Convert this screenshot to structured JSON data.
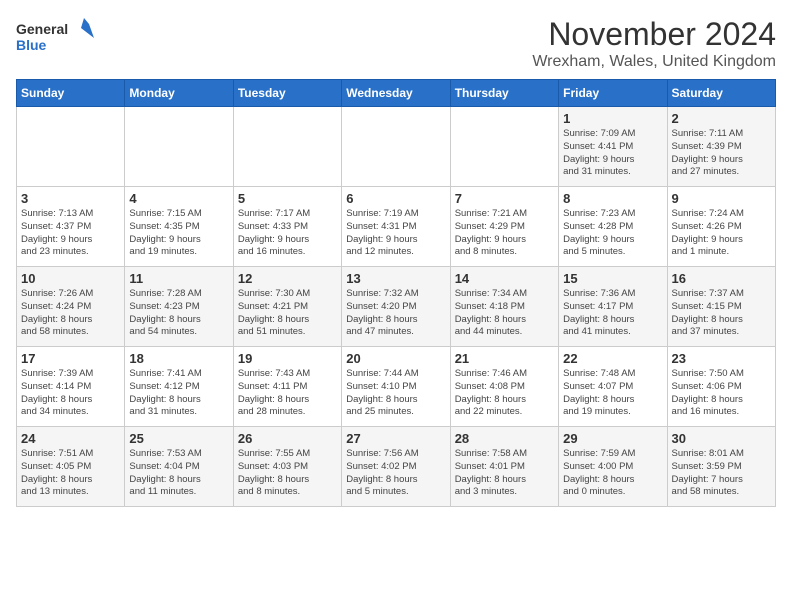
{
  "logo": {
    "line1": "General",
    "line2": "Blue"
  },
  "title": "November 2024",
  "subtitle": "Wrexham, Wales, United Kingdom",
  "days_of_week": [
    "Sunday",
    "Monday",
    "Tuesday",
    "Wednesday",
    "Thursday",
    "Friday",
    "Saturday"
  ],
  "weeks": [
    [
      {
        "day": "",
        "info": ""
      },
      {
        "day": "",
        "info": ""
      },
      {
        "day": "",
        "info": ""
      },
      {
        "day": "",
        "info": ""
      },
      {
        "day": "",
        "info": ""
      },
      {
        "day": "1",
        "info": "Sunrise: 7:09 AM\nSunset: 4:41 PM\nDaylight: 9 hours\nand 31 minutes."
      },
      {
        "day": "2",
        "info": "Sunrise: 7:11 AM\nSunset: 4:39 PM\nDaylight: 9 hours\nand 27 minutes."
      }
    ],
    [
      {
        "day": "3",
        "info": "Sunrise: 7:13 AM\nSunset: 4:37 PM\nDaylight: 9 hours\nand 23 minutes."
      },
      {
        "day": "4",
        "info": "Sunrise: 7:15 AM\nSunset: 4:35 PM\nDaylight: 9 hours\nand 19 minutes."
      },
      {
        "day": "5",
        "info": "Sunrise: 7:17 AM\nSunset: 4:33 PM\nDaylight: 9 hours\nand 16 minutes."
      },
      {
        "day": "6",
        "info": "Sunrise: 7:19 AM\nSunset: 4:31 PM\nDaylight: 9 hours\nand 12 minutes."
      },
      {
        "day": "7",
        "info": "Sunrise: 7:21 AM\nSunset: 4:29 PM\nDaylight: 9 hours\nand 8 minutes."
      },
      {
        "day": "8",
        "info": "Sunrise: 7:23 AM\nSunset: 4:28 PM\nDaylight: 9 hours\nand 5 minutes."
      },
      {
        "day": "9",
        "info": "Sunrise: 7:24 AM\nSunset: 4:26 PM\nDaylight: 9 hours\nand 1 minute."
      }
    ],
    [
      {
        "day": "10",
        "info": "Sunrise: 7:26 AM\nSunset: 4:24 PM\nDaylight: 8 hours\nand 58 minutes."
      },
      {
        "day": "11",
        "info": "Sunrise: 7:28 AM\nSunset: 4:23 PM\nDaylight: 8 hours\nand 54 minutes."
      },
      {
        "day": "12",
        "info": "Sunrise: 7:30 AM\nSunset: 4:21 PM\nDaylight: 8 hours\nand 51 minutes."
      },
      {
        "day": "13",
        "info": "Sunrise: 7:32 AM\nSunset: 4:20 PM\nDaylight: 8 hours\nand 47 minutes."
      },
      {
        "day": "14",
        "info": "Sunrise: 7:34 AM\nSunset: 4:18 PM\nDaylight: 8 hours\nand 44 minutes."
      },
      {
        "day": "15",
        "info": "Sunrise: 7:36 AM\nSunset: 4:17 PM\nDaylight: 8 hours\nand 41 minutes."
      },
      {
        "day": "16",
        "info": "Sunrise: 7:37 AM\nSunset: 4:15 PM\nDaylight: 8 hours\nand 37 minutes."
      }
    ],
    [
      {
        "day": "17",
        "info": "Sunrise: 7:39 AM\nSunset: 4:14 PM\nDaylight: 8 hours\nand 34 minutes."
      },
      {
        "day": "18",
        "info": "Sunrise: 7:41 AM\nSunset: 4:12 PM\nDaylight: 8 hours\nand 31 minutes."
      },
      {
        "day": "19",
        "info": "Sunrise: 7:43 AM\nSunset: 4:11 PM\nDaylight: 8 hours\nand 28 minutes."
      },
      {
        "day": "20",
        "info": "Sunrise: 7:44 AM\nSunset: 4:10 PM\nDaylight: 8 hours\nand 25 minutes."
      },
      {
        "day": "21",
        "info": "Sunrise: 7:46 AM\nSunset: 4:08 PM\nDaylight: 8 hours\nand 22 minutes."
      },
      {
        "day": "22",
        "info": "Sunrise: 7:48 AM\nSunset: 4:07 PM\nDaylight: 8 hours\nand 19 minutes."
      },
      {
        "day": "23",
        "info": "Sunrise: 7:50 AM\nSunset: 4:06 PM\nDaylight: 8 hours\nand 16 minutes."
      }
    ],
    [
      {
        "day": "24",
        "info": "Sunrise: 7:51 AM\nSunset: 4:05 PM\nDaylight: 8 hours\nand 13 minutes."
      },
      {
        "day": "25",
        "info": "Sunrise: 7:53 AM\nSunset: 4:04 PM\nDaylight: 8 hours\nand 11 minutes."
      },
      {
        "day": "26",
        "info": "Sunrise: 7:55 AM\nSunset: 4:03 PM\nDaylight: 8 hours\nand 8 minutes."
      },
      {
        "day": "27",
        "info": "Sunrise: 7:56 AM\nSunset: 4:02 PM\nDaylight: 8 hours\nand 5 minutes."
      },
      {
        "day": "28",
        "info": "Sunrise: 7:58 AM\nSunset: 4:01 PM\nDaylight: 8 hours\nand 3 minutes."
      },
      {
        "day": "29",
        "info": "Sunrise: 7:59 AM\nSunset: 4:00 PM\nDaylight: 8 hours\nand 0 minutes."
      },
      {
        "day": "30",
        "info": "Sunrise: 8:01 AM\nSunset: 3:59 PM\nDaylight: 7 hours\nand 58 minutes."
      }
    ]
  ]
}
